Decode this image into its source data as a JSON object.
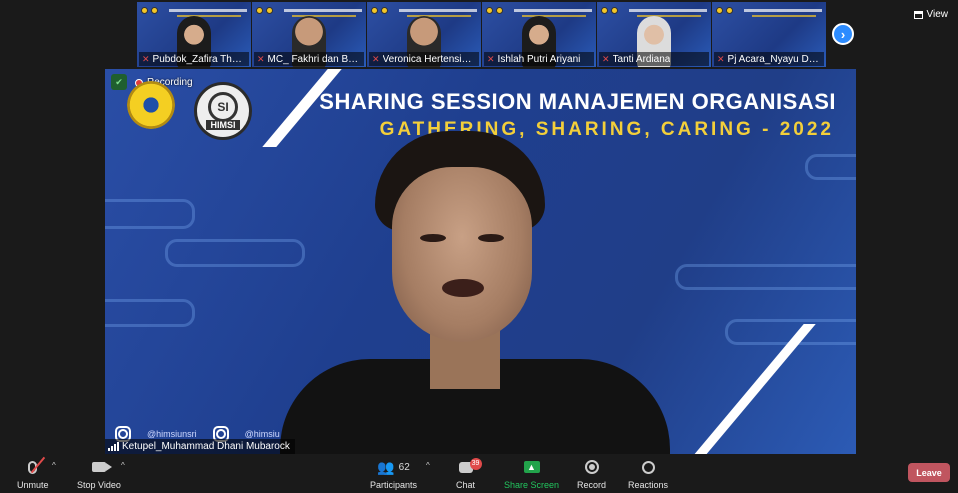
{
  "thumbnails": [
    {
      "name": "Pubdok_Zafira Thuraya",
      "style": "hijab"
    },
    {
      "name": "MC_ Fakhri dan Brintha",
      "style": "default"
    },
    {
      "name": "Veronica Hertensia Le...",
      "style": "default"
    },
    {
      "name": "Ishlah Putri Ariyani",
      "style": "hijab"
    },
    {
      "name": "Tanti Ardiana",
      "style": "light"
    },
    {
      "name": "Pj Acara_Nyayu Dwi T...",
      "style": "empty"
    }
  ],
  "header": {
    "view_label": "View",
    "next_icon": "chevron-right-icon"
  },
  "video": {
    "recording_label": "Recording",
    "title_line1": "SHARING SESSION MANAJEMEN ORGANISASI",
    "title_line2": "GATHERING, SHARING, CARING - 2022",
    "logo_si": "SI",
    "logo_himsi": "HIMSI",
    "social_1": "@himsiunsri",
    "social_2": "@himsiu",
    "speaker_name": "Ketupel_Muhammad Dhani Mubarock"
  },
  "toolbar": {
    "unmute_label": "Unmute",
    "stop_video_label": "Stop Video",
    "participants_label": "Participants",
    "participants_count": "62",
    "chat_label": "Chat",
    "chat_badge": "39",
    "share_label": "Share Screen",
    "record_label": "Record",
    "reactions_label": "Reactions",
    "leave_label": "Leave"
  },
  "colors": {
    "accent_blue": "#2d8cff",
    "share_green": "#22a34b",
    "leave_red": "#c0555f",
    "title_yellow": "#f3cf3a"
  }
}
